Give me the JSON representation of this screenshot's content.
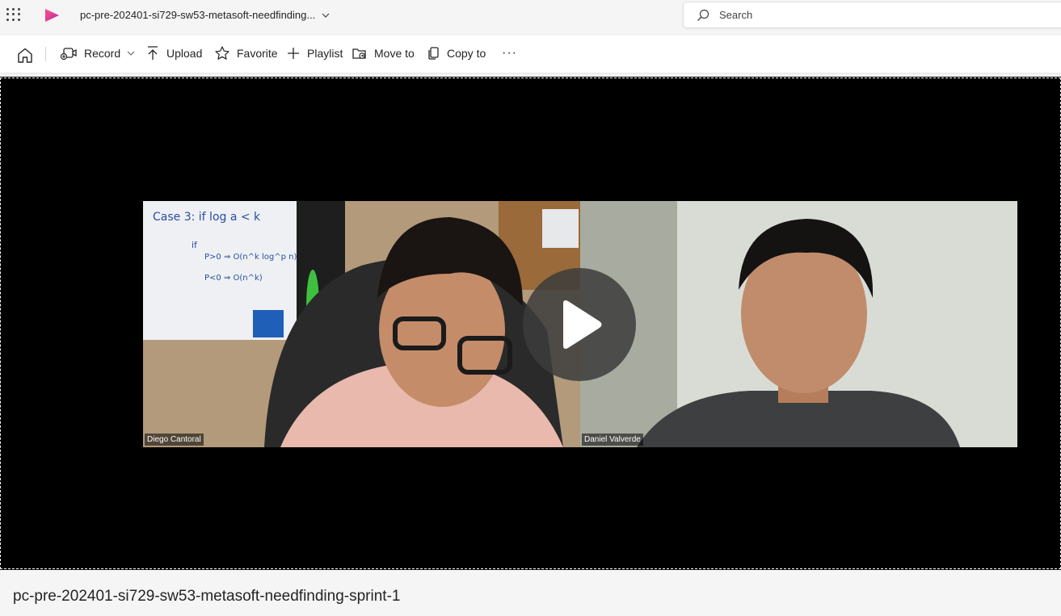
{
  "topbar": {
    "file_title": "pc-pre-202401-si729-sw53-metasoft-needfinding...",
    "search_placeholder": "Search"
  },
  "commands": {
    "record": "Record",
    "upload": "Upload",
    "favorite": "Favorite",
    "playlist": "Playlist",
    "move_to": "Move to",
    "copy_to": "Copy to",
    "more": "···"
  },
  "video": {
    "participants": [
      {
        "name": "Diego Cantoral"
      },
      {
        "name": "Daniel Valverde"
      }
    ],
    "whiteboard_text": [
      "Case 3: if log a < k",
      "if",
      "P>0 ⇒ O(n^k log^p n)",
      "P<0 ⇒ O(n^k)"
    ]
  },
  "video_title": "pc-pre-202401-si729-sw53-metasoft-needfinding-sprint-1",
  "colors": {
    "accent": "#d32f8a",
    "player_bg": "#000000"
  }
}
